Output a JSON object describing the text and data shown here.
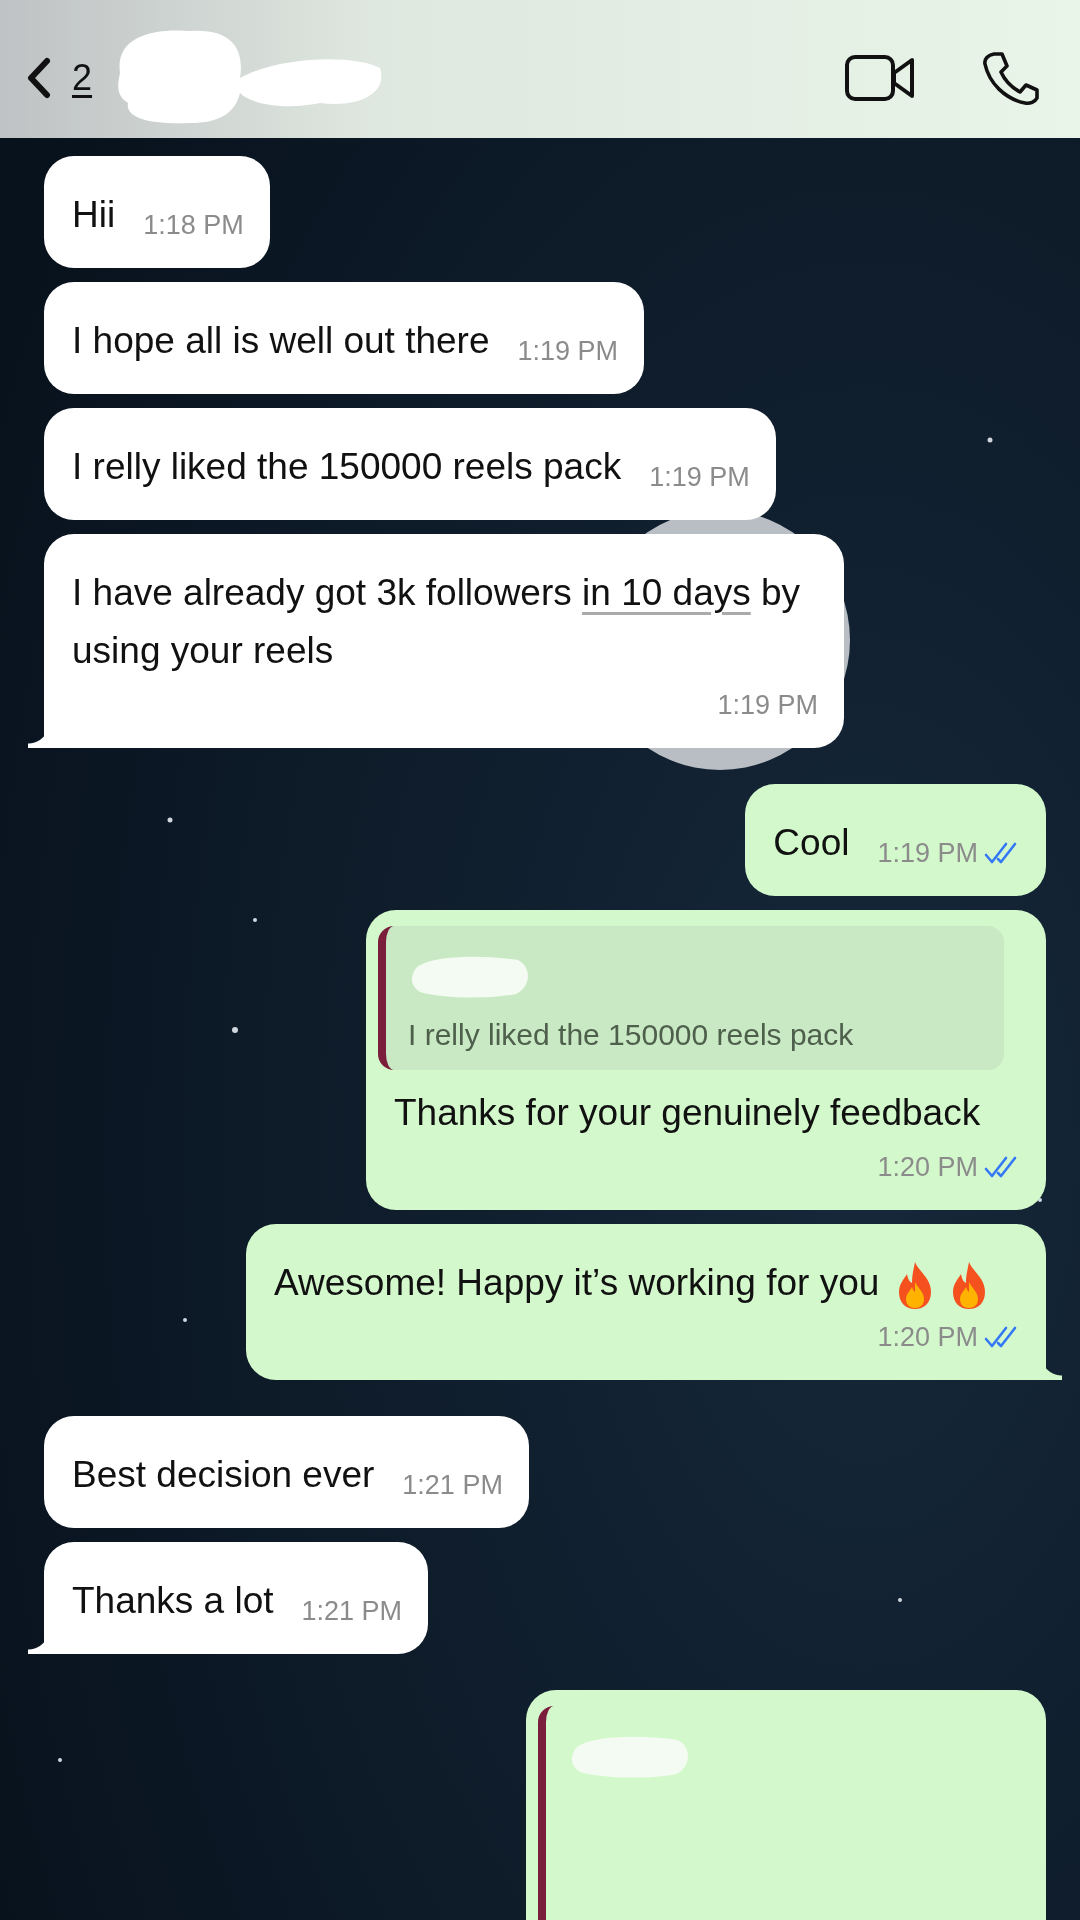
{
  "header": {
    "back_count": "2"
  },
  "messages": [
    {
      "kind": "text",
      "outgoing": false,
      "text": "Hii",
      "time": "1:18 PM",
      "tail": false
    },
    {
      "kind": "text",
      "outgoing": false,
      "text": "I hope all is well out there",
      "time": "1:19 PM",
      "tail": false
    },
    {
      "kind": "text",
      "outgoing": false,
      "text": "I relly liked the 150000 reels pack",
      "time": "1:19 PM",
      "tail": false
    },
    {
      "kind": "text",
      "outgoing": false,
      "text": "I have already got 3k followers ",
      "link": "in 10 days",
      "text_after": " by using your reels",
      "time": "1:19 PM",
      "tail": true
    },
    {
      "kind": "text",
      "outgoing": true,
      "text": "Cool",
      "time": "1:19 PM",
      "read": true,
      "tail": false
    },
    {
      "kind": "reply",
      "outgoing": true,
      "quote": "I relly liked the 150000 reels pack",
      "text": "Thanks for your genuinely feedback",
      "time": "1:20 PM",
      "read": true,
      "tail": false
    },
    {
      "kind": "text",
      "outgoing": true,
      "text": "Awesome! Happy it’s working for you",
      "emojis": [
        {
          "kind": "fire"
        },
        {
          "kind": "fire"
        }
      ],
      "time": "1:20 PM",
      "read": true,
      "tail": true
    },
    {
      "kind": "text",
      "outgoing": false,
      "text": "Best decision ever",
      "time": "1:21 PM",
      "tail": false
    },
    {
      "kind": "text",
      "outgoing": false,
      "text": "Thanks a lot",
      "time": "1:21 PM",
      "tail": true
    },
    {
      "kind": "reply_cut",
      "outgoing": true
    }
  ]
}
